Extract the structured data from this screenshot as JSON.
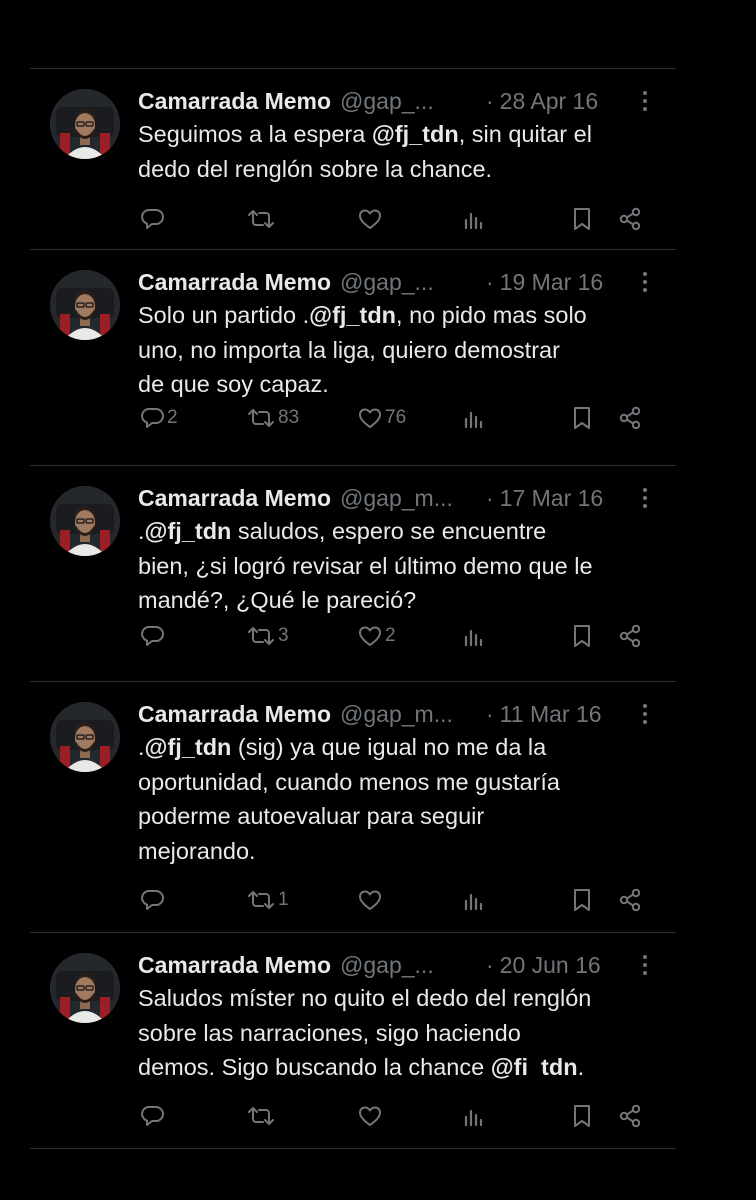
{
  "tweets": [
    {
      "name": "Camarrada Memo",
      "handle": "@gap_...",
      "date": "28 Apr 16",
      "text_segments": [
        {
          "text": "Seguimos a la espera ",
          "bold": false
        },
        {
          "text": "@fj_tdn",
          "bold": true
        },
        {
          "text": ", sin quitar el\ndedo del renglón sobre la chance.",
          "bold": false
        }
      ],
      "replies": "",
      "retweets": "",
      "likes": ""
    },
    {
      "name": "Camarrada Memo",
      "handle": "@gap_...",
      "date": "19 Mar 16",
      "text_segments": [
        {
          "text": "Solo un partido .",
          "bold": false
        },
        {
          "text": "@fj_tdn",
          "bold": true
        },
        {
          "text": ", no pido mas solo\nuno, no importa la liga, quiero demostrar\nde que soy capaz.",
          "bold": false
        }
      ],
      "replies": "2",
      "retweets": "83",
      "likes": "76"
    },
    {
      "name": "Camarrada Memo",
      "handle": "@gap_m...",
      "date": "17 Mar 16",
      "text_segments": [
        {
          "text": ".",
          "bold": false
        },
        {
          "text": "@fj_tdn",
          "bold": true
        },
        {
          "text": " saludos, espero se encuentre\nbien, ¿si logró revisar el último demo que le\nmandé?, ¿Qué le pareció?",
          "bold": false
        }
      ],
      "replies": "",
      "retweets": "3",
      "likes": "2"
    },
    {
      "name": "Camarrada Memo",
      "handle": "@gap_m...",
      "date": "11 Mar 16",
      "text_segments": [
        {
          "text": ".",
          "bold": false
        },
        {
          "text": "@fj_tdn",
          "bold": true
        },
        {
          "text": " (sig) ya que igual no me da la\noportunidad, cuando menos me gustaría\npoderme autoevaluar para seguir\nmejorando.",
          "bold": false
        }
      ],
      "replies": "",
      "retweets": "1",
      "likes": ""
    },
    {
      "name": "Camarrada Memo",
      "handle": "@gap_...",
      "date": "20 Jun 16",
      "text_segments": [
        {
          "text": "Saludos míster no quito el dedo del renglón\nsobre las narraciones, sigo haciendo\ndemos. Sigo buscando la chance ",
          "bold": false
        },
        {
          "text": "@fi  tdn",
          "bold": true
        },
        {
          "text": ".",
          "bold": false
        }
      ],
      "replies": "",
      "retweets": "",
      "likes": ""
    }
  ],
  "icons": {
    "reply": "reply-icon",
    "retweet": "retweet-icon",
    "like": "heart-icon",
    "views": "views-chart-icon",
    "bookmark": "bookmark-icon",
    "share": "share-icon",
    "more": "more-options-icon"
  },
  "colors": {
    "background": "#000000",
    "primary_text": "#e7e9ea",
    "secondary_text": "#71767b",
    "divider": "#2a2d31"
  }
}
